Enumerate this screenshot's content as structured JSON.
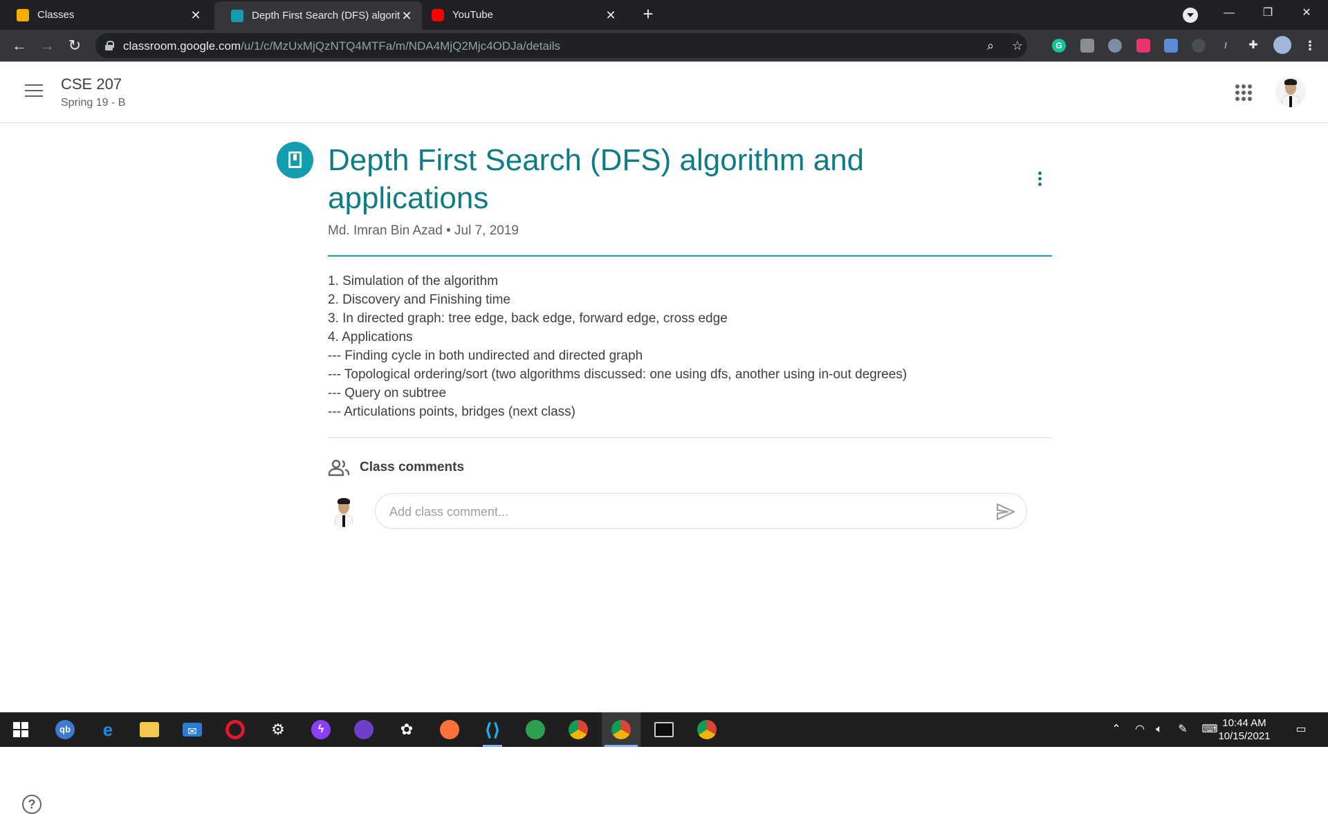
{
  "browser": {
    "tabs": [
      {
        "title": "Classes",
        "favicon_color": "#f9ab00"
      },
      {
        "title": "Depth First Search (DFS) algorithm and applications",
        "favicon_color": "#129eaf"
      },
      {
        "title": "YouTube",
        "favicon_color": "#ff0000"
      }
    ],
    "new_tab": "+",
    "url_host": "classroom.google.com",
    "url_path": "/u/1/c/MzUxMjQzNTQ4MTFa/m/NDA4MjQ2Mjc4ODJa/details"
  },
  "classroom": {
    "course_title": "CSE 207",
    "course_section": "Spring 19 - B"
  },
  "material": {
    "title": "Depth First Search (DFS) algorithm and applications",
    "author": "Md. Imran Bin Azad",
    "separator": "•",
    "date": "Jul 7, 2019",
    "description": [
      "1. Simulation of the algorithm",
      "2. Discovery and Finishing time",
      "3. In directed graph: tree edge, back edge, forward edge, cross edge",
      "4. Applications",
      "--- Finding cycle in both undirected and directed graph",
      "--- Topological ordering/sort (two algorithms discussed: one using dfs, another using in-out degrees)",
      "--- Query on subtree",
      "--- Articulations points, bridges (next class)"
    ]
  },
  "comments": {
    "heading": "Class comments",
    "placeholder": "Add class comment..."
  },
  "taskbar": {
    "time": "10:44 AM",
    "date": "10/15/2021"
  },
  "colors": {
    "accent": "#129eaf",
    "title_teal": "#0e7c86"
  }
}
